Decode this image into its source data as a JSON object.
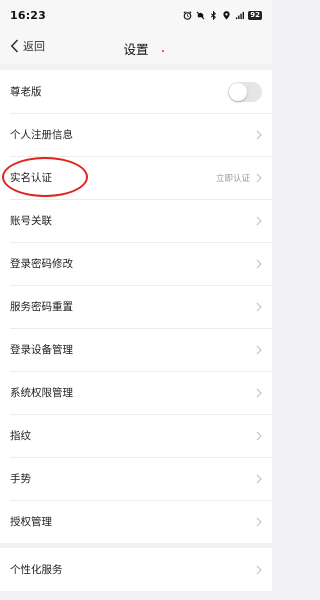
{
  "status_bar": {
    "time": "16:23",
    "signal": "5G",
    "battery": "92"
  },
  "nav": {
    "back_label": "返回",
    "title": "设置"
  },
  "settings": {
    "elder_mode": {
      "label": "尊老版",
      "enabled": false
    },
    "items": [
      {
        "label": "个人注册信息"
      },
      {
        "label": "实名认证",
        "value": "立即认证"
      },
      {
        "label": "账号关联"
      },
      {
        "label": "登录密码修改"
      },
      {
        "label": "服务密码重置"
      },
      {
        "label": "登录设备管理"
      },
      {
        "label": "系统权限管理"
      },
      {
        "label": "指纹"
      },
      {
        "label": "手势"
      },
      {
        "label": "授权管理"
      }
    ],
    "personalized": {
      "label": "个性化服务"
    }
  },
  "colors": {
    "annotation": "#e0241c",
    "background": "#f2f2f4"
  }
}
